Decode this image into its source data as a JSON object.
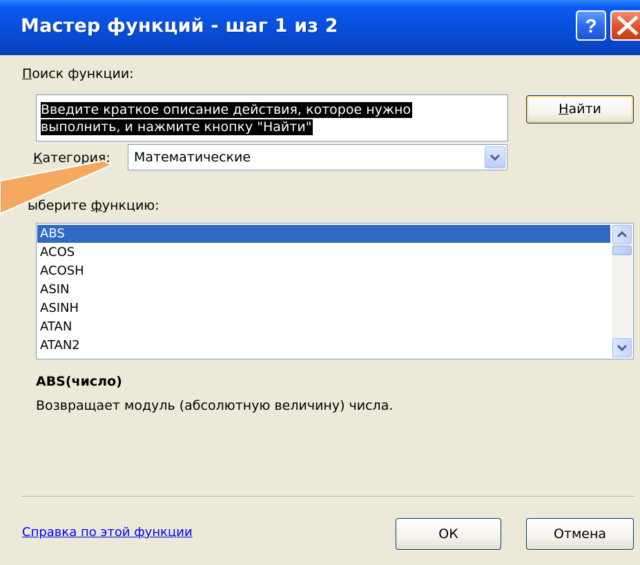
{
  "window": {
    "title": "Мастер функций - шаг 1 из 2"
  },
  "title_buttons": {
    "help_icon": "question-mark-icon",
    "close_icon": "close-x-icon"
  },
  "search": {
    "label_accesskey": "П",
    "label_rest": "оиск функции:",
    "text_line1": "Введите краткое описание действия, которое нужно",
    "text_line2": "выполнить, и нажмите кнопку \"Найти\"",
    "find_accesskey": "Н",
    "find_rest": "айти"
  },
  "category": {
    "label_accesskey": "К",
    "label_rest": "атегория:",
    "value": "Математические"
  },
  "function_list": {
    "label_pre": "ыберите ",
    "label_accesskey": "ф",
    "label_post": "ункцию:",
    "items": [
      "ABS",
      "ACOS",
      "ACOSH",
      "ASIN",
      "ASINH",
      "ATAN",
      "ATAN2"
    ],
    "selected": "ABS"
  },
  "description": {
    "signature": "ABS(число)",
    "text": "Возвращает модуль (абсолютную величину) числа."
  },
  "footer": {
    "help_link": "Справка по этой функции",
    "ok_label": "ОК",
    "cancel_label": "Отмена"
  },
  "colors": {
    "titlebar": "#0a5bf0",
    "dialog_bg": "#ece9d8",
    "selection": "#316ac5",
    "arrow": "#f4a860"
  }
}
